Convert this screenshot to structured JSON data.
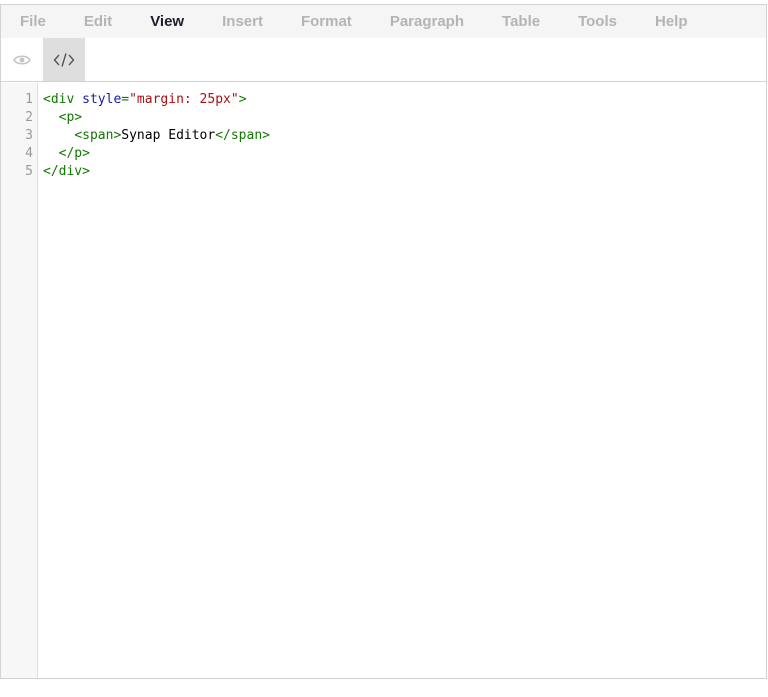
{
  "menubar": {
    "items": [
      "File",
      "Edit",
      "View",
      "Insert",
      "Format",
      "Paragraph",
      "Table",
      "Tools",
      "Help"
    ],
    "active_index": 2
  },
  "toolbar": {
    "buttons": [
      {
        "icon": "eye-icon",
        "active": false
      },
      {
        "icon": "code-icon",
        "active": true
      }
    ]
  },
  "code_editor": {
    "line_numbers": [
      "1",
      "2",
      "3",
      "4",
      "5"
    ],
    "lines": [
      [
        {
          "t": "tag",
          "v": "<div "
        },
        {
          "t": "attr",
          "v": "style"
        },
        {
          "t": "tag",
          "v": "="
        },
        {
          "t": "str",
          "v": "\"margin: 25px\""
        },
        {
          "t": "tag",
          "v": ">"
        }
      ],
      [
        {
          "t": "txt",
          "v": "  "
        },
        {
          "t": "tag",
          "v": "<p>"
        }
      ],
      [
        {
          "t": "txt",
          "v": "    "
        },
        {
          "t": "tag",
          "v": "<span>"
        },
        {
          "t": "txt",
          "v": "Synap Editor"
        },
        {
          "t": "tag",
          "v": "</span>"
        }
      ],
      [
        {
          "t": "txt",
          "v": "  "
        },
        {
          "t": "tag",
          "v": "</p>"
        }
      ],
      [
        {
          "t": "tag",
          "v": "</div>"
        }
      ]
    ]
  },
  "colors": {
    "tag": "#117700",
    "attr": "#1a1aa6",
    "string": "#aa1111",
    "menu_active": "#1e1e2e",
    "menu_inactive": "#b4b4b4"
  }
}
